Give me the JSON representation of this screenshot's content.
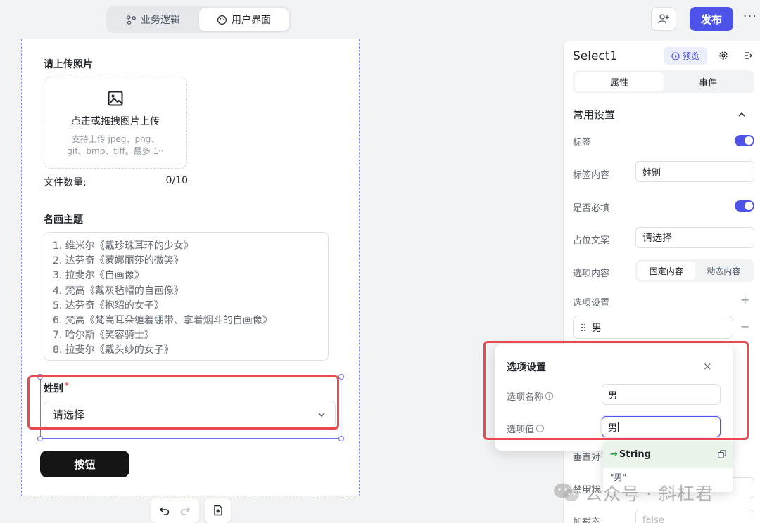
{
  "topbar": {
    "tabs": [
      {
        "label": "业务逻辑",
        "active": false
      },
      {
        "label": "用户界面",
        "active": true
      }
    ],
    "publish_label": "发布",
    "more_label": "···"
  },
  "canvas": {
    "upload": {
      "label": "请上传照片",
      "title": "点击或拖拽图片上传",
      "hint": "支持上传 jpeg、png、gif、bmp、tiff。最多 1··",
      "count_label": "文件数量:",
      "count_value": "0/10"
    },
    "theme": {
      "label": "名画主题",
      "lines": [
        "1. 维米尔《戴珍珠耳环的少女》",
        "2. 达芬奇《蒙娜丽莎的微笑》",
        "3. 拉斐尔《自画像》",
        "4. 梵高《戴灰毡帽的自画像》",
        "5. 达芬奇《抱貂的女子》",
        "6. 梵高《梵高耳朵缠着绷带、拿着烟斗的自画像》",
        "7. 哈尔斯《笑容骑士》",
        "8. 拉斐尔《戴头纱的女子》"
      ]
    },
    "gender": {
      "label": "姓别",
      "required_mark": "*",
      "placeholder": "请选择"
    },
    "button_label": "按钮"
  },
  "panel": {
    "title": "Select1",
    "preview_label": "预览",
    "tabs": [
      "属性",
      "事件"
    ],
    "section_title": "常用设置",
    "rows": {
      "label_toggle": "标签",
      "label_content": "标签内容",
      "label_content_value": "姓别",
      "required": "是否必填",
      "placeholder_label": "占位文案",
      "placeholder_value": "请选择",
      "options_content": "选项内容",
      "options_mode": [
        "固定内容",
        "动态内容"
      ],
      "options_settings": "选项设置",
      "option_item": "男",
      "vertical_align": "垂直对齐",
      "disabled_label": "禁用状态",
      "loading_label": "加载态",
      "loading_value": "false"
    },
    "plus": "+",
    "minus": "−"
  },
  "popover": {
    "title": "选项设置",
    "close": "×",
    "name_label": "选项名称",
    "name_value": "男",
    "value_label": "选项值",
    "value_value": "男",
    "suggest_type": "String",
    "suggest_value": "\"男\""
  },
  "watermark": "公众号 · 斜杠君",
  "colors": {
    "accent": "#4d53e8",
    "highlight_red": "#e84a4f",
    "button_dark": "#151515"
  }
}
